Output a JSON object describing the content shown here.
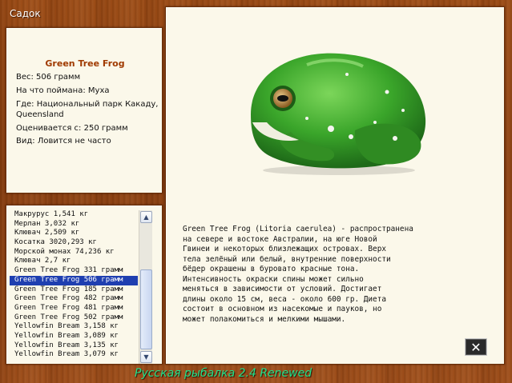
{
  "window": {
    "title": "Садок"
  },
  "fish_info": {
    "name": "Green Tree Frog",
    "weight": "Вес: 506 грамм",
    "bait": "На что поймана: Муха",
    "location": "Где: Национальный парк Какаду, Queensland",
    "value": "Оценивается с: 250 грамм",
    "type": "Вид: Ловится не часто"
  },
  "catch_list": {
    "items": [
      "Макрурус 1,541 кг",
      "Мерлан 3,032 кг",
      "Клювач 2,509 кг",
      "Косатка 3020,293 кг",
      "Морской монах 74,236 кг",
      "Клювач 2,7 кг",
      "Green Tree Frog 331 грамм",
      "Green Tree Frog 506 грамм",
      "Green Tree Frog 185 грамм",
      "Green Tree Frog 482 грамм",
      "Green Tree Frog 481 грамм",
      "Green Tree Frog 502 грамм",
      "Yellowfin Bream 3,158 кг",
      "Yellowfin Bream 3,089 кг",
      "Yellowfin Bream 3,135 кг",
      "Yellowfin Bream 3,079 кг"
    ],
    "selected_index": 7,
    "scroll_up_icon": "arrow-up-icon",
    "scroll_down_icon": "arrow-down-icon"
  },
  "description": {
    "lines": [
      "Green Tree Frog (Litoria caerulea) - распространена",
      "на севере и востоке Австралии, на юге Новой",
      "Гвинеи и некоторых близлежащих островах. Верх",
      "тела зелёный или белый, внутренние поверхности",
      "бёдер окрашены в буровато красные тона.",
      "Интенсивность окраски спины может сильно",
      "меняться в зависимости от условий. Достигает",
      "длины около 15 см, веса - около 600 гр. Диета",
      "состоит в основном из насекомые и пауков, но",
      "может полакомиться и мелкими мышами."
    ]
  },
  "close_button": {
    "label": "✕",
    "icon": "close-icon"
  },
  "footer": {
    "text": "Русская рыбалка 2.4 Renewed"
  },
  "colors": {
    "frame_wood": "#8f4412",
    "panel_bg": "#fbf8ea",
    "fish_name": "#a03a00",
    "selection": "#1f3fb0",
    "footer_text": "#22e08a"
  }
}
